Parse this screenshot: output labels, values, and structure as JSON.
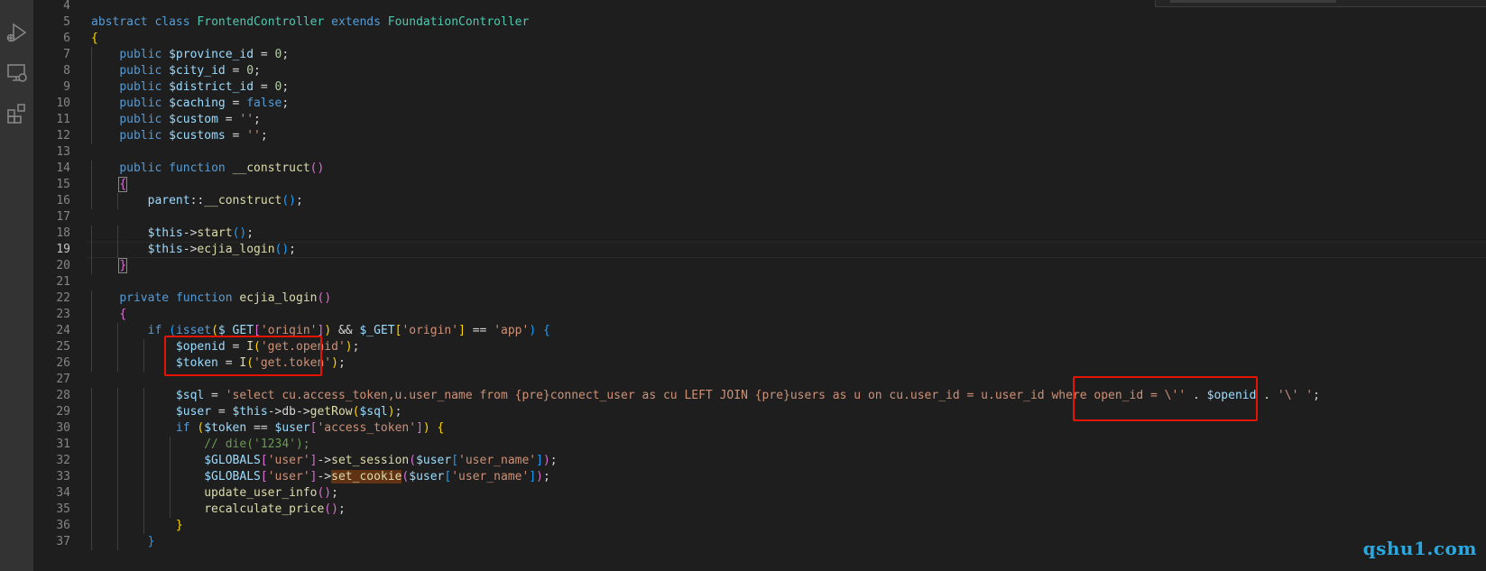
{
  "editor": {
    "active_line": 19,
    "lines": [
      {
        "n": "4",
        "code": ""
      },
      {
        "n": "5",
        "code": "abstract class FrontendController extends FoundationController"
      },
      {
        "n": "6",
        "code": "{"
      },
      {
        "n": "7",
        "code": "    public $province_id = 0;"
      },
      {
        "n": "8",
        "code": "    public $city_id = 0;"
      },
      {
        "n": "9",
        "code": "    public $district_id = 0;"
      },
      {
        "n": "10",
        "code": "    public $caching = false;"
      },
      {
        "n": "11",
        "code": "    public $custom = '';"
      },
      {
        "n": "12",
        "code": "    public $customs = '';"
      },
      {
        "n": "13",
        "code": ""
      },
      {
        "n": "14",
        "code": "    public function __construct()"
      },
      {
        "n": "15",
        "code": "    {"
      },
      {
        "n": "16",
        "code": "        parent::__construct();"
      },
      {
        "n": "17",
        "code": ""
      },
      {
        "n": "18",
        "code": "        $this->start();"
      },
      {
        "n": "19",
        "code": "        $this->ecjia_login();"
      },
      {
        "n": "20",
        "code": "    }"
      },
      {
        "n": "21",
        "code": ""
      },
      {
        "n": "22",
        "code": "    private function ecjia_login()"
      },
      {
        "n": "23",
        "code": "    {"
      },
      {
        "n": "24",
        "code": "        if (isset($_GET['origin']) && $_GET['origin'] == 'app') {"
      },
      {
        "n": "25",
        "code": "            $openid = I('get.openid');"
      },
      {
        "n": "26",
        "code": "            $token = I('get.token');"
      },
      {
        "n": "27",
        "code": ""
      },
      {
        "n": "28",
        "code": "            $sql = 'select cu.access_token,u.user_name from {pre}connect_user as cu LEFT JOIN {pre}users as u on cu.user_id = u.user_id where open_id = \\'' . $openid . '\\' ';"
      },
      {
        "n": "29",
        "code": "            $user = $this->db->getRow($sql);"
      },
      {
        "n": "30",
        "code": "            if ($token == $user['access_token']) {"
      },
      {
        "n": "31",
        "code": "                // die('1234');"
      },
      {
        "n": "32",
        "code": "                $GLOBALS['user']->set_session($user['user_name']);"
      },
      {
        "n": "33",
        "code": "                $GLOBALS['user']->set_cookie($user['user_name']);"
      },
      {
        "n": "34",
        "code": "                update_user_info();"
      },
      {
        "n": "35",
        "code": "                recalculate_price();"
      },
      {
        "n": "36",
        "code": "            }"
      },
      {
        "n": "37",
        "code": "        }"
      }
    ]
  },
  "activity_bar": {
    "icons": [
      "run-debug-icon",
      "remote-explorer-icon",
      "extensions-icon"
    ]
  },
  "colors": {
    "background": "#1e1e1e",
    "activity_bar": "#333333",
    "annotation_box": "#e51400",
    "watermark": "#2aa8e0"
  },
  "watermark": {
    "text": "qshu1.com"
  }
}
